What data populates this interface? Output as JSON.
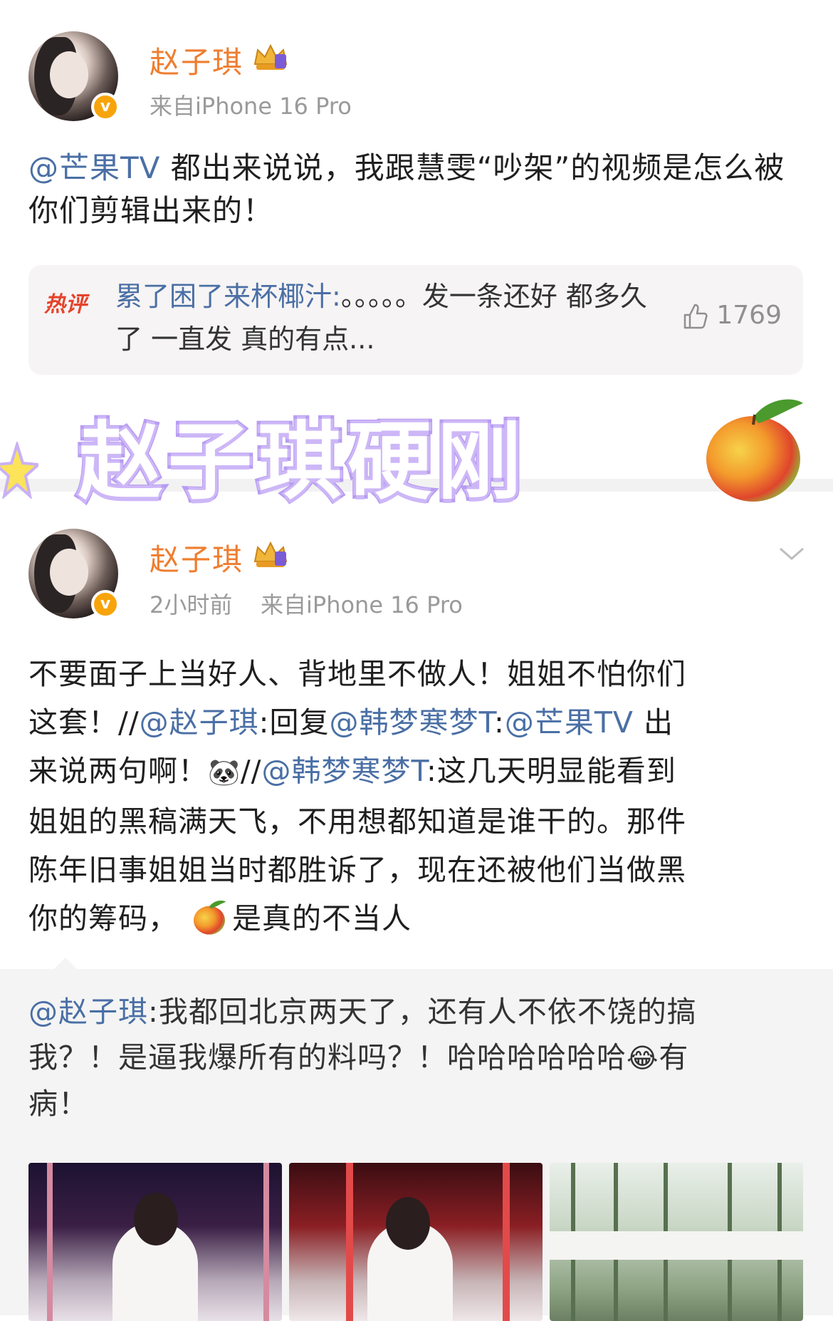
{
  "post1": {
    "username": "赵子琪",
    "source": "来自iPhone 16 Pro",
    "mention": "@芒果TV",
    "text": " 都出来说说，我跟慧雯“吵架”的视频是怎么被你们剪辑出来的！",
    "hot_comment": {
      "tag": "热评",
      "user": "累了困了来杯椰汁:",
      "text": "。。。。。发一条还好 都多久了 一直发 真的有点...",
      "likes": "1769"
    }
  },
  "overlay": {
    "title": "赵子琪硬刚"
  },
  "post2": {
    "username": "赵子琪",
    "time": "2小时前",
    "source": "来自iPhone 16 Pro",
    "line1": "不要面子上当好人、背地里不做人！姐姐不怕你们",
    "line2_a": "这套！//",
    "line2_m1": "@赵子琪",
    "line2_b": ":回复",
    "line2_m2": "@韩梦寒梦T",
    "line2_c": ":",
    "line2_m3": "@芒果TV",
    "line2_d": " 出",
    "line3_a": "来说两句啊！",
    "line3_b": "//",
    "line3_m1": "@韩梦寒梦T",
    "line3_c": ":这几天明显能看到",
    "line4": "姐姐的黑稿满天飞，不用想都知道是谁干的。那件",
    "line5": "陈年旧事姐姐当时都胜诉了，现在还被他们当做黑",
    "line6_a": "你的筹码，",
    "line6_b": "是真的不当人",
    "retweet": {
      "mention": "@赵子琪",
      "line1": ":我都回北京两天了，还有人不依不饶的搞",
      "line2": "我？！是逼我爆所有的料吗？！哈哈哈哈哈哈",
      "line2_tail": "有",
      "line3": "病！"
    }
  },
  "icons": {
    "verified": "v",
    "emoji_laugh": "😂",
    "emoji_panda": "🐼"
  },
  "colors": {
    "username": "#ef7d2f",
    "mention": "#4a6fa5",
    "hot": "#e5432c",
    "overlay_stroke": "#b79cf1"
  }
}
